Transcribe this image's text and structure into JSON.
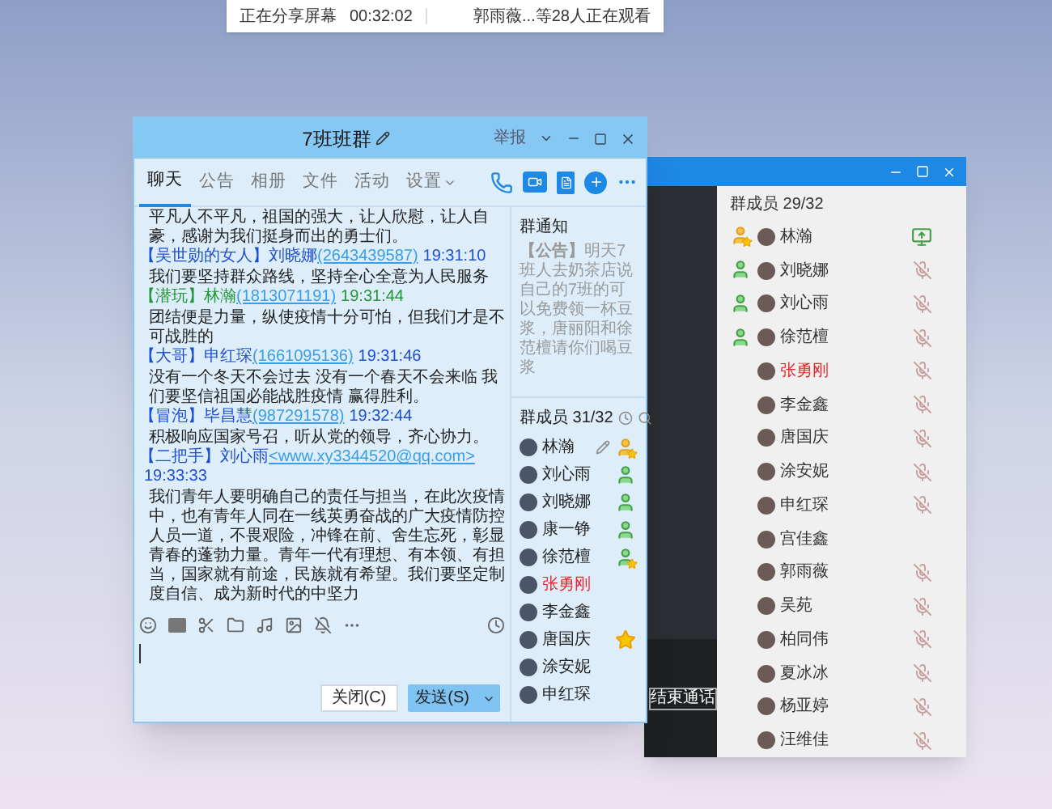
{
  "share_bar": {
    "status": "正在分享屏幕",
    "duration": "00:32:02",
    "viewers": "郭雨薇...等28人正在观看"
  },
  "chat_window": {
    "title": "7班班群",
    "report": "举报",
    "tabs": [
      {
        "label": "聊天",
        "selected": true
      },
      {
        "label": "公告",
        "selected": false
      },
      {
        "label": "相册",
        "selected": false
      },
      {
        "label": "文件",
        "selected": false
      },
      {
        "label": "活动",
        "selected": false
      },
      {
        "label": "设置",
        "selected": false
      }
    ],
    "messages": [
      {
        "kind": "text",
        "text": "平凡人不平凡，祖国的强大，让人欣慰，让人自豪，感谢为我们挺身而出的勇士们。"
      },
      {
        "kind": "header",
        "tag": "【吴世勋的女人】",
        "name": "刘晓娜",
        "contact": "(2643439587)",
        "time": "19:31:10",
        "color": "#1f4fd1"
      },
      {
        "kind": "text",
        "text": "我们要坚持群众路线，坚持全心全意为人民服务"
      },
      {
        "kind": "header",
        "tag": "【潜玩】",
        "name": "林瀚",
        "contact": "(1813071191)",
        "time": "19:31:44",
        "color": "#23963a"
      },
      {
        "kind": "text",
        "text": "团结便是力量，纵使疫情十分可怕，但我们才是不可战胜的"
      },
      {
        "kind": "header",
        "tag": "【大哥】",
        "name": "申红琛",
        "contact": "(1661095136)",
        "time": "19:31:46",
        "color": "#1f4fd1"
      },
      {
        "kind": "text",
        "text": "没有一个冬天不会过去 没有一个春天不会来临 我们要坚信祖国必能战胜疫情 赢得胜利。"
      },
      {
        "kind": "header",
        "tag": "【冒泡】",
        "name": "毕昌慧",
        "contact": "(987291578)",
        "time": "19:32:44",
        "color": "#1f4fd1"
      },
      {
        "kind": "text",
        "text": "积极响应国家号召，听从党的领导，齐心协力。"
      },
      {
        "kind": "header",
        "tag": "【二把手】",
        "name": "刘心雨",
        "contact": "<www.xy3344520@qq.com>",
        "time": "19:33:33",
        "color": "#1f4fd1"
      },
      {
        "kind": "text",
        "text": "我们青年人要明确自己的责任与担当，在此次疫情中，也有青年人同在一线英勇奋战的广大疫情防控人员一道，不畏艰险，冲锋在前、舍生忘死，彰显青春的蓬勃力量。青年一代有理想、有本领、有担当，国家就有前途，民族就有希望。我们要坚定制度自信、成为新时代的中坚力"
      }
    ],
    "notice": {
      "title": "群通知",
      "text": "**【公告】**明天7班人去奶茶店说自己的7班的可以免费领一杯豆浆，唐丽阳和徐范檀请你们喝豆浆"
    },
    "members": {
      "title": "群成员 31/32",
      "items": [
        {
          "name": "林瀚",
          "kind": "owner",
          "editable": true,
          "highlighted": false
        },
        {
          "name": "刘心雨",
          "kind": "admin",
          "editable": false,
          "highlighted": false
        },
        {
          "name": "刘晓娜",
          "kind": "admin",
          "editable": false,
          "highlighted": false
        },
        {
          "name": "康一铮",
          "kind": "admin",
          "editable": false,
          "highlighted": false
        },
        {
          "name": "徐范檀",
          "kind": "senior",
          "editable": false,
          "highlighted": false
        },
        {
          "name": "张勇刚",
          "kind": "plain",
          "editable": false,
          "highlighted": true
        },
        {
          "name": "李金鑫",
          "kind": "plain",
          "editable": false,
          "highlighted": false
        },
        {
          "name": "唐国庆",
          "kind": "vip",
          "editable": false,
          "highlighted": false
        },
        {
          "name": "涂安妮",
          "kind": "plain",
          "editable": false,
          "highlighted": false
        },
        {
          "name": "申红琛",
          "kind": "plain",
          "editable": false,
          "highlighted": false
        }
      ]
    },
    "close_button": "关闭(C)",
    "send_button": "发送(S)"
  },
  "call_window": {
    "end_call": "结束通话",
    "members": {
      "title": "群成员 29/32",
      "items": [
        {
          "name": "林瀚",
          "kind": "owner",
          "sharing": true,
          "muted": false,
          "highlighted": false
        },
        {
          "name": "刘晓娜",
          "kind": "admin",
          "sharing": false,
          "muted": true,
          "highlighted": false
        },
        {
          "name": "刘心雨",
          "kind": "admin",
          "sharing": false,
          "muted": true,
          "highlighted": false
        },
        {
          "name": "徐范檀",
          "kind": "admin",
          "sharing": false,
          "muted": true,
          "highlighted": false
        },
        {
          "name": "张勇刚",
          "kind": "plain",
          "sharing": false,
          "muted": true,
          "highlighted": true
        },
        {
          "name": "李金鑫",
          "kind": "plain",
          "sharing": false,
          "muted": true,
          "highlighted": false
        },
        {
          "name": "唐国庆",
          "kind": "plain",
          "sharing": false,
          "muted": true,
          "highlighted": false
        },
        {
          "name": "涂安妮",
          "kind": "plain",
          "sharing": false,
          "muted": true,
          "highlighted": false
        },
        {
          "name": "申红琛",
          "kind": "plain",
          "sharing": false,
          "muted": true,
          "highlighted": false
        },
        {
          "name": "宫佳鑫",
          "kind": "plain",
          "sharing": false,
          "muted": false,
          "highlighted": false
        },
        {
          "name": "郭雨薇",
          "kind": "plain",
          "sharing": false,
          "muted": true,
          "highlighted": false
        },
        {
          "name": "吴苑",
          "kind": "plain",
          "sharing": false,
          "muted": true,
          "highlighted": false
        },
        {
          "name": "柏同伟",
          "kind": "plain",
          "sharing": false,
          "muted": true,
          "highlighted": false
        },
        {
          "name": "夏冰冰",
          "kind": "plain",
          "sharing": false,
          "muted": true,
          "highlighted": false
        },
        {
          "name": "杨亚婷",
          "kind": "plain",
          "sharing": false,
          "muted": true,
          "highlighted": false
        },
        {
          "name": "汪维佳",
          "kind": "plain",
          "sharing": false,
          "muted": true,
          "highlighted": false
        }
      ]
    }
  }
}
